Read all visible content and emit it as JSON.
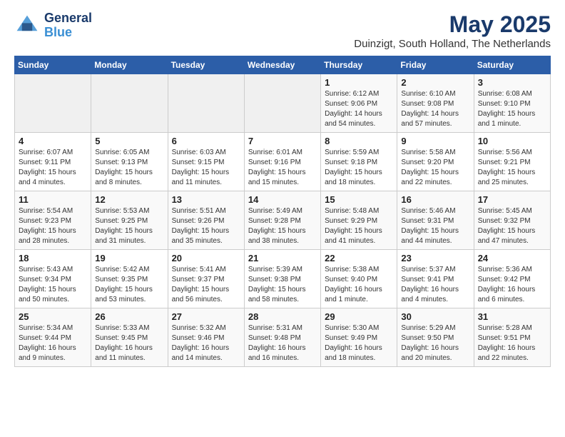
{
  "logo": {
    "text_general": "General",
    "text_blue": "Blue"
  },
  "header": {
    "month_title": "May 2025",
    "subtitle": "Duinzigt, South Holland, The Netherlands"
  },
  "weekdays": [
    "Sunday",
    "Monday",
    "Tuesday",
    "Wednesday",
    "Thursday",
    "Friday",
    "Saturday"
  ],
  "weeks": [
    [
      {
        "day": "",
        "info": ""
      },
      {
        "day": "",
        "info": ""
      },
      {
        "day": "",
        "info": ""
      },
      {
        "day": "",
        "info": ""
      },
      {
        "day": "1",
        "info": "Sunrise: 6:12 AM\nSunset: 9:06 PM\nDaylight: 14 hours\nand 54 minutes."
      },
      {
        "day": "2",
        "info": "Sunrise: 6:10 AM\nSunset: 9:08 PM\nDaylight: 14 hours\nand 57 minutes."
      },
      {
        "day": "3",
        "info": "Sunrise: 6:08 AM\nSunset: 9:10 PM\nDaylight: 15 hours\nand 1 minute."
      }
    ],
    [
      {
        "day": "4",
        "info": "Sunrise: 6:07 AM\nSunset: 9:11 PM\nDaylight: 15 hours\nand 4 minutes."
      },
      {
        "day": "5",
        "info": "Sunrise: 6:05 AM\nSunset: 9:13 PM\nDaylight: 15 hours\nand 8 minutes."
      },
      {
        "day": "6",
        "info": "Sunrise: 6:03 AM\nSunset: 9:15 PM\nDaylight: 15 hours\nand 11 minutes."
      },
      {
        "day": "7",
        "info": "Sunrise: 6:01 AM\nSunset: 9:16 PM\nDaylight: 15 hours\nand 15 minutes."
      },
      {
        "day": "8",
        "info": "Sunrise: 5:59 AM\nSunset: 9:18 PM\nDaylight: 15 hours\nand 18 minutes."
      },
      {
        "day": "9",
        "info": "Sunrise: 5:58 AM\nSunset: 9:20 PM\nDaylight: 15 hours\nand 22 minutes."
      },
      {
        "day": "10",
        "info": "Sunrise: 5:56 AM\nSunset: 9:21 PM\nDaylight: 15 hours\nand 25 minutes."
      }
    ],
    [
      {
        "day": "11",
        "info": "Sunrise: 5:54 AM\nSunset: 9:23 PM\nDaylight: 15 hours\nand 28 minutes."
      },
      {
        "day": "12",
        "info": "Sunrise: 5:53 AM\nSunset: 9:25 PM\nDaylight: 15 hours\nand 31 minutes."
      },
      {
        "day": "13",
        "info": "Sunrise: 5:51 AM\nSunset: 9:26 PM\nDaylight: 15 hours\nand 35 minutes."
      },
      {
        "day": "14",
        "info": "Sunrise: 5:49 AM\nSunset: 9:28 PM\nDaylight: 15 hours\nand 38 minutes."
      },
      {
        "day": "15",
        "info": "Sunrise: 5:48 AM\nSunset: 9:29 PM\nDaylight: 15 hours\nand 41 minutes."
      },
      {
        "day": "16",
        "info": "Sunrise: 5:46 AM\nSunset: 9:31 PM\nDaylight: 15 hours\nand 44 minutes."
      },
      {
        "day": "17",
        "info": "Sunrise: 5:45 AM\nSunset: 9:32 PM\nDaylight: 15 hours\nand 47 minutes."
      }
    ],
    [
      {
        "day": "18",
        "info": "Sunrise: 5:43 AM\nSunset: 9:34 PM\nDaylight: 15 hours\nand 50 minutes."
      },
      {
        "day": "19",
        "info": "Sunrise: 5:42 AM\nSunset: 9:35 PM\nDaylight: 15 hours\nand 53 minutes."
      },
      {
        "day": "20",
        "info": "Sunrise: 5:41 AM\nSunset: 9:37 PM\nDaylight: 15 hours\nand 56 minutes."
      },
      {
        "day": "21",
        "info": "Sunrise: 5:39 AM\nSunset: 9:38 PM\nDaylight: 15 hours\nand 58 minutes."
      },
      {
        "day": "22",
        "info": "Sunrise: 5:38 AM\nSunset: 9:40 PM\nDaylight: 16 hours\nand 1 minute."
      },
      {
        "day": "23",
        "info": "Sunrise: 5:37 AM\nSunset: 9:41 PM\nDaylight: 16 hours\nand 4 minutes."
      },
      {
        "day": "24",
        "info": "Sunrise: 5:36 AM\nSunset: 9:42 PM\nDaylight: 16 hours\nand 6 minutes."
      }
    ],
    [
      {
        "day": "25",
        "info": "Sunrise: 5:34 AM\nSunset: 9:44 PM\nDaylight: 16 hours\nand 9 minutes."
      },
      {
        "day": "26",
        "info": "Sunrise: 5:33 AM\nSunset: 9:45 PM\nDaylight: 16 hours\nand 11 minutes."
      },
      {
        "day": "27",
        "info": "Sunrise: 5:32 AM\nSunset: 9:46 PM\nDaylight: 16 hours\nand 14 minutes."
      },
      {
        "day": "28",
        "info": "Sunrise: 5:31 AM\nSunset: 9:48 PM\nDaylight: 16 hours\nand 16 minutes."
      },
      {
        "day": "29",
        "info": "Sunrise: 5:30 AM\nSunset: 9:49 PM\nDaylight: 16 hours\nand 18 minutes."
      },
      {
        "day": "30",
        "info": "Sunrise: 5:29 AM\nSunset: 9:50 PM\nDaylight: 16 hours\nand 20 minutes."
      },
      {
        "day": "31",
        "info": "Sunrise: 5:28 AM\nSunset: 9:51 PM\nDaylight: 16 hours\nand 22 minutes."
      }
    ]
  ]
}
